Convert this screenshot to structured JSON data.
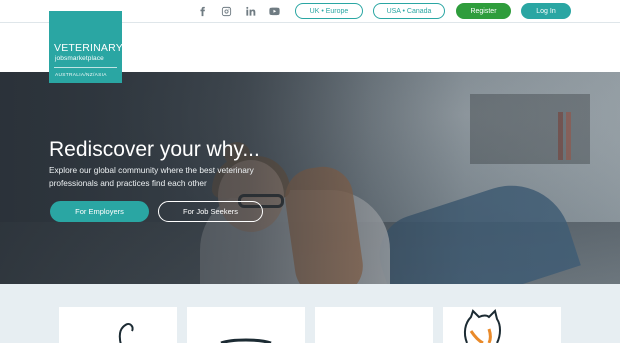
{
  "brand": {
    "line1": "VETERINARY",
    "line2": "jobsmarketplace",
    "region": "AUSTRALIA/NZ/ASIA",
    "color": "#2aa6a3"
  },
  "social": [
    {
      "name": "facebook-icon",
      "glyph": "f"
    },
    {
      "name": "instagram-icon",
      "glyph": ""
    },
    {
      "name": "linkedin-icon",
      "glyph": "in"
    },
    {
      "name": "youtube-icon",
      "glyph": ""
    }
  ],
  "nav": {
    "uk_europe": "UK • Europe",
    "usa_canada": "USA • Canada",
    "register": "Register",
    "login": "Log In"
  },
  "hero": {
    "headline": "Rediscover your why...",
    "subtext": "Explore our global community where the best veterinary professionals and practices find each other",
    "cta_employers": "For Employers",
    "cta_seekers": "For Job Seekers"
  },
  "colors": {
    "accent": "#2aa6a3",
    "register": "#2f9d3c",
    "cards_bg": "#e7eef2"
  }
}
